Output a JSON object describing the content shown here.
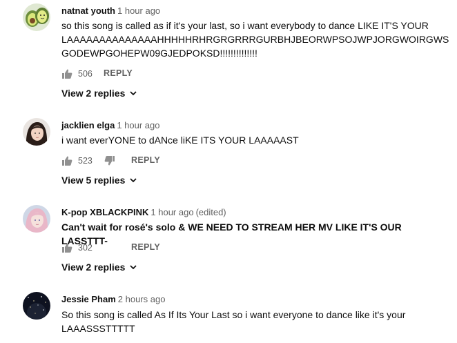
{
  "comments": [
    {
      "author": "natnat youth",
      "time": "1 hour ago",
      "edited": "",
      "lines": [
        "so this song is called as if it's your last, so i want everybody to dance LIKE IT'S YOUR",
        "LAAAAAAAAAAAAAAHHHHHRHRGRGRRRGURBHJBEORWPSOJWPJORGWOIRGWS",
        "GODEWPGOHEPW09GJEDPOKSD!!!!!!!!!!!!!!"
      ],
      "likes": "506",
      "reply_label": "REPLY",
      "replies_label": "View 2 replies",
      "avatar": "avocado-avatar"
    },
    {
      "author": "jacklien elga",
      "time": "1 hour ago",
      "edited": "",
      "lines": [
        "i want everYONE to dANce liKE ITS YOUR LAAAAAST"
      ],
      "likes": "523",
      "reply_label": "REPLY",
      "replies_label": "View 5 replies",
      "avatar": "girl-avatar"
    },
    {
      "author": "K-pop XBLACKPINK",
      "time": "1 hour ago",
      "edited": "(edited)",
      "lines": [
        "Can't wait for rosé's solo & WE NEED TO STREAM HER MV LIKE IT'S OUR LASSTTT-"
      ],
      "likes": "302",
      "reply_label": "REPLY",
      "replies_label": "View 2 replies",
      "avatar": "pink-hair-avatar"
    },
    {
      "author": "Jessie Pham",
      "time": "2 hours ago",
      "edited": "",
      "lines": [
        "So this song is called As If Its Your Last so i want everyone to dance like it's your",
        "LAAASSSTTTTT"
      ],
      "avatar": "night-sky-avatar"
    }
  ],
  "colors": {
    "meta": "#606060",
    "text": "#0d0d0d",
    "icon": "#909090"
  }
}
